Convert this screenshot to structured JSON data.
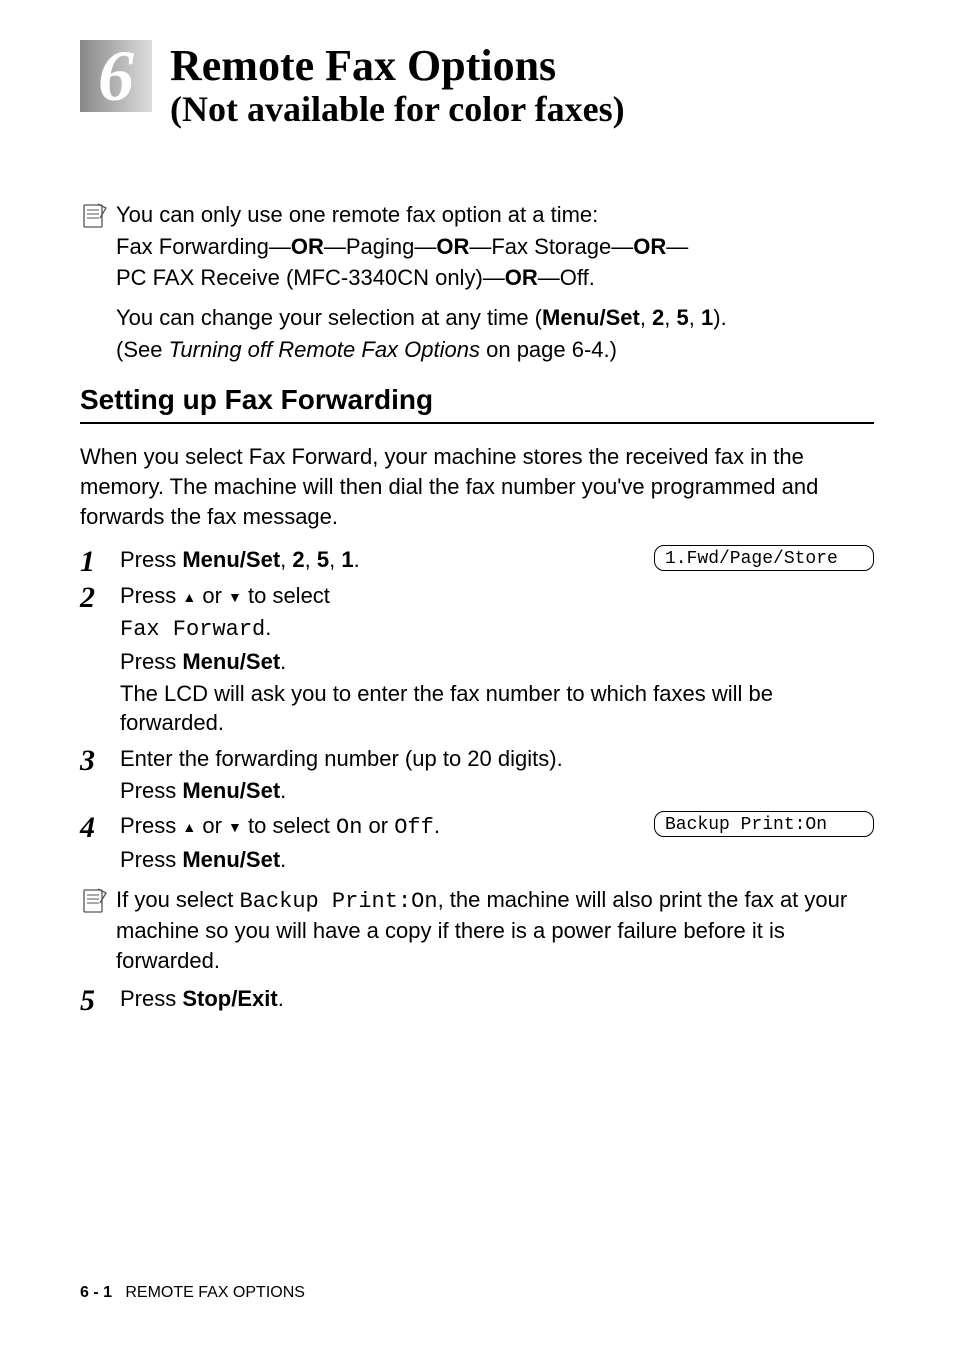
{
  "chapter": {
    "number": "6",
    "title": "Remote Fax Options",
    "subtitle": "(Not available for color faxes)"
  },
  "note1": {
    "line1": "You can only use one remote fax option at a time:",
    "line2a": "Fax Forwarding—",
    "or": "OR",
    "line2b": "—Paging—",
    "line2c": "—Fax Storage—",
    "line2d": "—",
    "line3a": "PC FAX Receive (MFC-3340CN only)—",
    "line3b": "—Off.",
    "line4a": "You can change your selection at any time (",
    "menu_set": "Menu/Set",
    "line4b": ", ",
    "k2": "2",
    "k5": "5",
    "k1": "1",
    "line4c": ").",
    "line5a": "(See ",
    "line5_italic": "Turning off Remote Fax Options",
    "line5b": " on page 6-4.)"
  },
  "section_heading": "Setting up Fax Forwarding",
  "intro": "When you select Fax Forward, your machine stores the received fax in the memory. The machine will then dial the fax number you've programmed and forwards the fax message.",
  "steps": {
    "s1": {
      "num": "1",
      "text_a": "Press ",
      "menu_set": "Menu/Set",
      "comma": ", ",
      "k2": "2",
      "k5": "5",
      "k1": "1",
      "period": ".",
      "lcd": "1.Fwd/Page/Store"
    },
    "s2": {
      "num": "2",
      "text_a": "Press ",
      "text_b": " or ",
      "text_c": " to select",
      "mono": "Fax Forward",
      "period": ".",
      "press": "Press ",
      "menu_set": "Menu/Set",
      "period2": ".",
      "lcd_note": "The LCD will ask you to enter the fax number to which faxes will be forwarded."
    },
    "s3": {
      "num": "3",
      "text": "Enter the forwarding number (up to 20 digits).",
      "press": "Press ",
      "menu_set": "Menu/Set",
      "period": "."
    },
    "s4": {
      "num": "4",
      "text_a": "Press ",
      "text_b": " or ",
      "text_c": " to select ",
      "on": "On",
      "or_word": " or ",
      "off": "Off",
      "period": ".",
      "press": "Press ",
      "menu_set": "Menu/Set",
      "period2": ".",
      "lcd": "Backup Print:On"
    },
    "s5": {
      "num": "5",
      "press": "Press ",
      "stop_exit": "Stop/Exit",
      "period": "."
    }
  },
  "note2": {
    "text_a": "If you select ",
    "mono": "Backup Print:On",
    "text_b": ", the machine will also print the fax at your machine so you will have a copy if there is a power failure before it is forwarded."
  },
  "footer": {
    "page": "6 - 1",
    "label": "REMOTE FAX OPTIONS"
  }
}
